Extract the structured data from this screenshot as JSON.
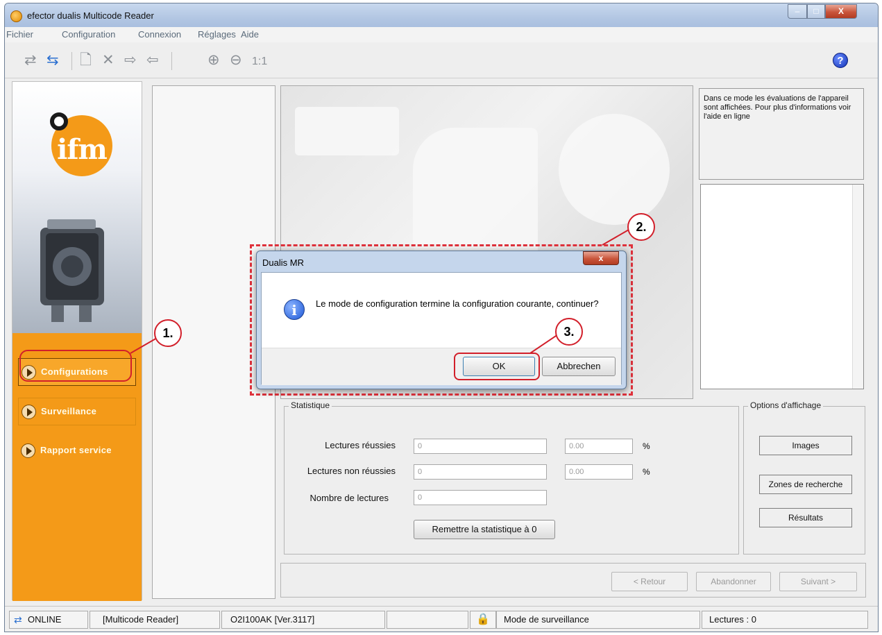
{
  "window": {
    "title": "efector dualis Multicode Reader",
    "controls": {
      "minimize": "–",
      "maximize": "□",
      "close": "X"
    }
  },
  "menu": [
    "Fichier",
    "Configuration",
    "Connexion",
    "Réglages",
    "Aide"
  ],
  "toolbar": {
    "zoom_label": "1:1",
    "help_label": "?"
  },
  "sidebar": {
    "logo_text": "ifm",
    "items": [
      {
        "label": "Configurations",
        "active": true
      },
      {
        "label": "Surveillance",
        "active": false
      },
      {
        "label": "Rapport service",
        "active": false
      }
    ]
  },
  "info_text": "Dans ce mode les évaluations de l'appareil sont affichées. Pour plus d'informations voir l'aide en ligne",
  "statistics": {
    "legend": "Statistique",
    "rows": [
      {
        "label": "Lectures réussies",
        "count": "0",
        "percent": "0.00",
        "unit": "%"
      },
      {
        "label": "Lectures non réussies",
        "count": "0",
        "percent": "0.00",
        "unit": "%"
      },
      {
        "label": "Nombre de lectures",
        "count": "0"
      }
    ],
    "reset_button": "Remettre la statistique à 0"
  },
  "display_options": {
    "legend": "Options d'affichage",
    "buttons": [
      "Images",
      "Zones de recherche",
      "Résultats"
    ]
  },
  "wizard": {
    "back": "< Retour",
    "abort": "Abandonner",
    "next": "Suivant >"
  },
  "status": {
    "connection": "ONLINE",
    "device": "[Multicode Reader]",
    "firmware": "O2I100AK  [Ver.3117]",
    "mode": "Mode de surveillance",
    "reads": "Lectures : 0"
  },
  "dialog": {
    "title": "Dualis MR",
    "close": "x",
    "message": "Le mode de configuration termine la configuration courante, continuer?",
    "ok": "OK",
    "cancel": "Abbrechen"
  },
  "callouts": [
    "1.",
    "2.",
    "3."
  ],
  "colors": {
    "accent": "#f49a18",
    "highlight": "#d21f2a"
  }
}
